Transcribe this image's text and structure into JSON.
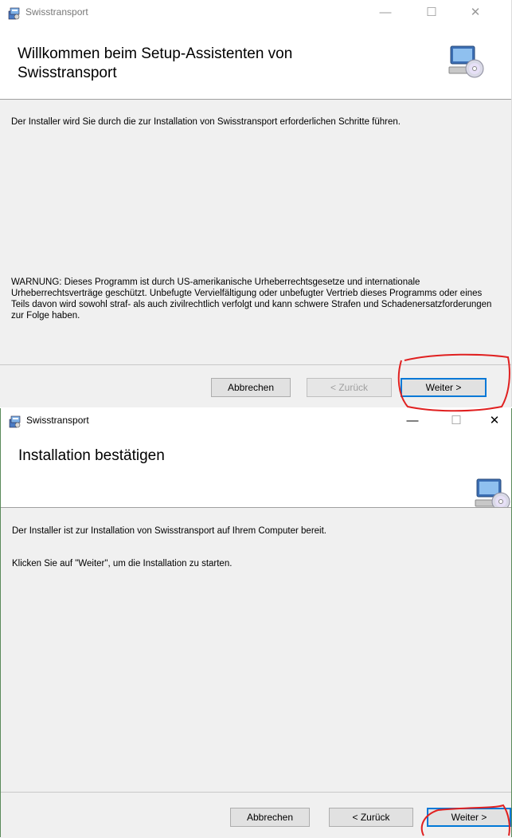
{
  "window1": {
    "app_title": "Swisstransport",
    "heading": "Willkommen beim Setup-Assistenten von Swisstransport",
    "intro": "Der Installer wird Sie durch die zur Installation von Swisstransport erforderlichen Schritte führen.",
    "warning": "WARNUNG: Dieses Programm ist durch US-amerikanische Urheberrechtsgesetze und internationale Urheberrechtsverträge geschützt. Unbefugte Vervielfältigung oder unbefugter Vertrieb dieses Programms oder eines Teils davon wird sowohl straf- als auch zivilrechtlich verfolgt und kann schwere Strafen und Schadenersatzforderungen zur Folge haben.",
    "buttons": {
      "cancel": "Abbrechen",
      "back": "< Zurück",
      "next": "Weiter >"
    },
    "back_enabled": false
  },
  "window2": {
    "app_title": "Swisstransport",
    "heading": "Installation bestätigen",
    "line1": "Der Installer ist zur Installation von Swisstransport auf Ihrem Computer bereit.",
    "line2": "Klicken Sie auf \"Weiter\", um die Installation zu starten.",
    "buttons": {
      "cancel": "Abbrechen",
      "back": "< Zurück",
      "next": "Weiter >"
    },
    "back_enabled": true
  },
  "caption_glyphs": {
    "minimize": "—",
    "maximize": "☐",
    "close": "✕"
  },
  "icons": {
    "app": "installer-package-icon",
    "banner": "computer-cd-icon"
  },
  "colors": {
    "accent": "#0078d7",
    "annotation": "#e02020"
  }
}
